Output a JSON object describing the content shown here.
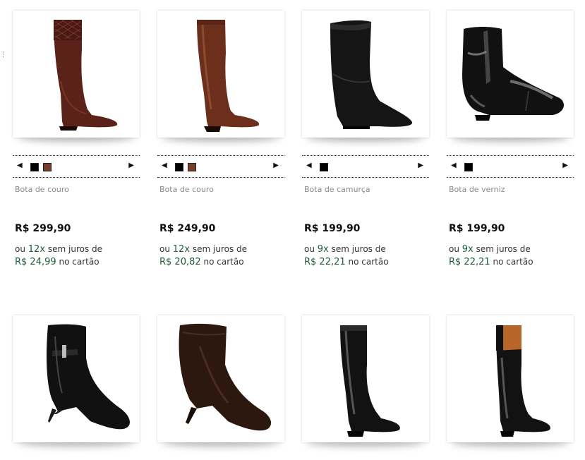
{
  "colors": {
    "accent_green": "#1e5c38",
    "muted_text": "#8a8a8a",
    "swatch_black": "#000000",
    "swatch_brown": "#7a3b2a"
  },
  "decor": {
    "dots": "⋮"
  },
  "nav": {
    "prev_icon": "◀",
    "next_icon": "▶"
  },
  "texts": {
    "ou": "ou",
    "sem_juros": "sem juros de",
    "no_cartao": "no cartão"
  },
  "products": [
    {
      "name": "Bota de couro",
      "price": "R$ 299,90",
      "installments": "12x",
      "installment_value": "R$ 24,99",
      "swatches": [
        "black",
        "brown"
      ],
      "icon": "tall-boot-quilted-brown"
    },
    {
      "name": "Bota de couro",
      "price": "R$ 249,90",
      "installments": "12x",
      "installment_value": "R$ 20,82",
      "swatches": [
        "black",
        "brown"
      ],
      "icon": "tall-boot-brown"
    },
    {
      "name": "Bota de camurça",
      "price": "R$ 199,90",
      "installments": "9x",
      "installment_value": "R$ 22,21",
      "swatches": [
        "black"
      ],
      "icon": "slouch-boot-black-suede"
    },
    {
      "name": "Bota de verniz",
      "price": "R$ 199,90",
      "installments": "9x",
      "installment_value": "R$ 22,21",
      "swatches": [
        "black"
      ],
      "icon": "ankle-boot-black-patent"
    },
    {
      "icon": "heeled-ankle-boot-black"
    },
    {
      "icon": "heeled-ankle-boot-brown"
    },
    {
      "icon": "tall-boot-black"
    },
    {
      "icon": "tall-boot-black-tan-cuff"
    }
  ]
}
